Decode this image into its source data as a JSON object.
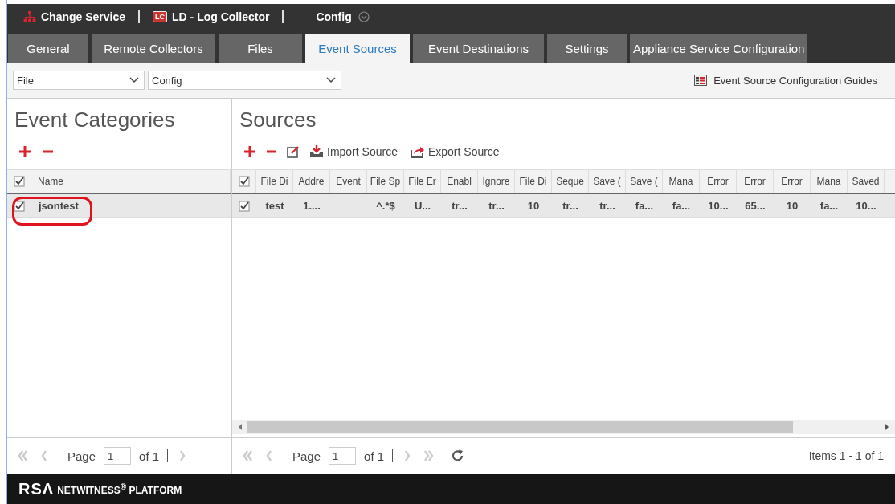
{
  "header": {
    "items": [
      {
        "kind": "service",
        "label": "Change Service"
      },
      {
        "kind": "device",
        "badge": "LC",
        "label": "LD - Log Collector"
      },
      {
        "kind": "menu",
        "label": "Config"
      }
    ]
  },
  "tabs": [
    {
      "label": "General",
      "selected": false
    },
    {
      "label": "Remote Collectors",
      "selected": false
    },
    {
      "label": "Files",
      "selected": false
    },
    {
      "label": "Event Sources",
      "selected": true
    },
    {
      "label": "Event Destinations",
      "selected": false
    },
    {
      "label": "Settings",
      "selected": false
    },
    {
      "label": "Appliance Service Configuration",
      "selected": false
    }
  ],
  "toolbar": {
    "type_select": "File",
    "config_select": "Config",
    "guides_link": "Event Source Configuration Guides"
  },
  "categories": {
    "title": "Event Categories",
    "header_checked": true,
    "columns": [
      "Name"
    ],
    "rows": [
      {
        "checked": true,
        "selected": true,
        "cells": [
          "jsontest"
        ]
      }
    ],
    "pager": {
      "buttons": [
        {
          "kind": "first",
          "disabled": true
        },
        {
          "kind": "prev",
          "disabled": true
        },
        {
          "kind": "next",
          "disabled": true
        }
      ],
      "page_label": "Page",
      "page": "1",
      "of": "of 1"
    }
  },
  "sources": {
    "title": "Sources",
    "actions": [
      {
        "kind": "add"
      },
      {
        "kind": "remove"
      },
      {
        "kind": "edit"
      },
      {
        "kind": "import",
        "label": "Import Source"
      },
      {
        "kind": "export",
        "label": "Export Source"
      }
    ],
    "header_checked": true,
    "columns": [
      "File Di",
      "Addre",
      "Event",
      "File Sp",
      "File Er",
      "Enabl",
      "Ignore",
      "File Di",
      "Seque",
      "Save (",
      "Save (",
      "Mana",
      "Error",
      "Error",
      "Error",
      "Mana",
      "Saved"
    ],
    "rows": [
      {
        "checked": true,
        "selected": true,
        "cells": [
          "test",
          "1....",
          "",
          "^.*$",
          "U...",
          "tr...",
          "tr...",
          "10",
          "tr...",
          "tr...",
          "fa...",
          "fa...",
          "10...",
          "65...",
          "10",
          "fa...",
          "10..."
        ]
      }
    ],
    "pager": {
      "buttons": [
        {
          "kind": "first",
          "disabled": true
        },
        {
          "kind": "prev",
          "disabled": true
        },
        {
          "kind": "next",
          "disabled": true
        },
        {
          "kind": "last",
          "disabled": true
        },
        {
          "kind": "refresh",
          "disabled": false
        }
      ],
      "page_label": "Page",
      "page": "1",
      "of": "of 1",
      "items": "Items 1 - 1 of 1"
    }
  },
  "footer": {
    "brand": "RSΛ",
    "product": "NETWITNESS$^{®}$ PLATFORM"
  }
}
